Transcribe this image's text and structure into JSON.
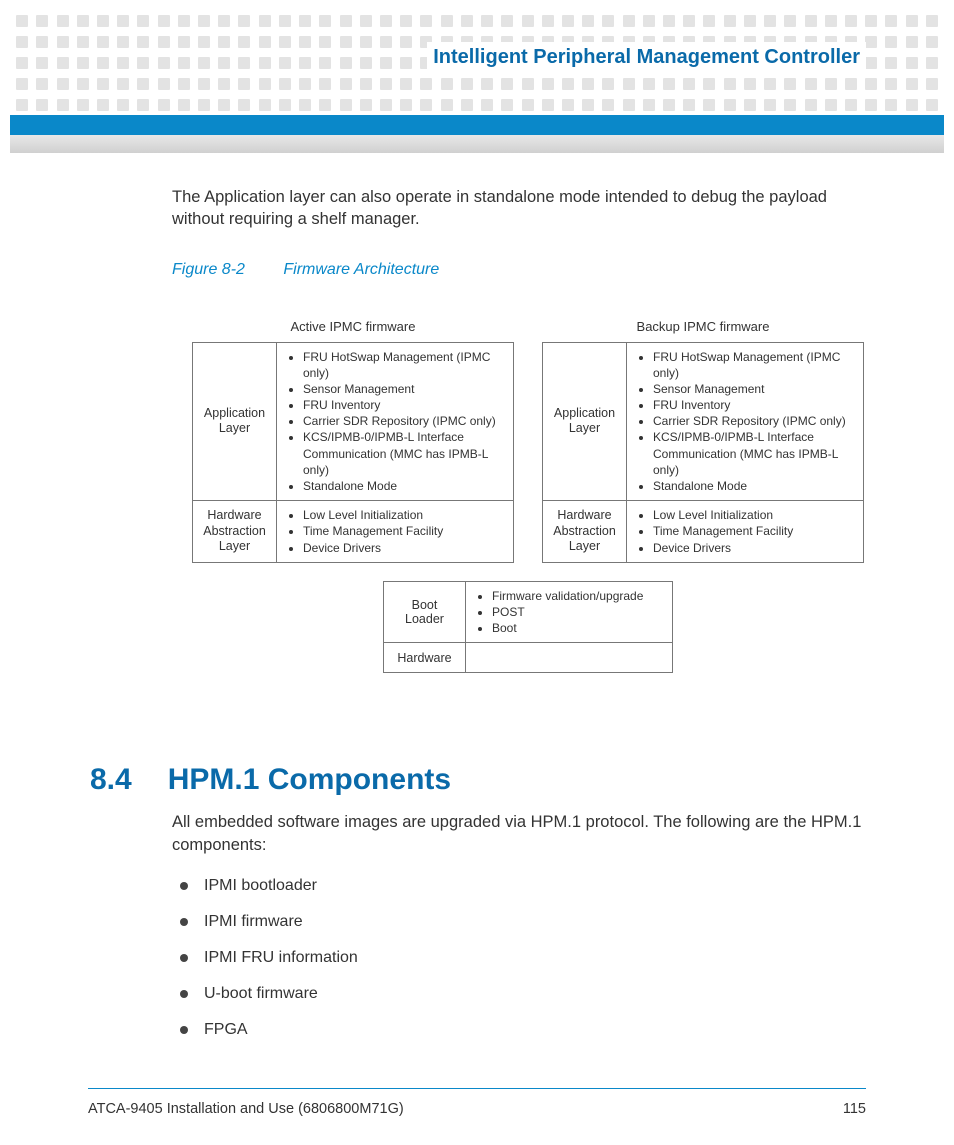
{
  "header": {
    "title": "Intelligent Peripheral Management Controller"
  },
  "intro_paragraph": "The Application layer can also operate in standalone mode intended to debug the payload without requiring a shelf manager.",
  "figure": {
    "label": "Figure 8-2",
    "title": "Firmware Architecture",
    "active": {
      "title": "Active IPMC firmware",
      "app_label": "Application Layer",
      "app_items": [
        "FRU HotSwap Management (IPMC only)",
        "Sensor Management",
        "FRU Inventory",
        "Carrier SDR Repository (IPMC only)",
        "KCS/IPMB-0/IPMB-L Interface Communication (MMC has IPMB-L only)",
        "Standalone Mode"
      ],
      "hal_label": "Hardware Abstraction Layer",
      "hal_items": [
        "Low Level Initialization",
        "Time Management Facility",
        "Device Drivers"
      ]
    },
    "backup": {
      "title": "Backup IPMC firmware",
      "app_label": "Application Layer",
      "app_items": [
        "FRU HotSwap Management (IPMC only)",
        "Sensor Management",
        "FRU Inventory",
        "Carrier SDR Repository (IPMC only)",
        "KCS/IPMB-0/IPMB-L Interface Communication (MMC has IPMB-L only)",
        "Standalone Mode"
      ],
      "hal_label": "Hardware Abstraction Layer",
      "hal_items": [
        "Low Level Initialization",
        "Time Management Facility",
        "Device Drivers"
      ]
    },
    "boot": {
      "label": "Boot Loader",
      "items": [
        "Firmware validation/upgrade",
        "POST",
        "Boot"
      ],
      "hw_label": "Hardware"
    }
  },
  "section": {
    "number": "8.4",
    "title": "HPM.1 Components",
    "paragraph": "All embedded software images are upgraded via HPM.1 protocol. The following are the HPM.1 components:",
    "bullets": [
      "IPMI bootloader",
      "IPMI firmware",
      "IPMI FRU information",
      "U-boot firmware",
      "FPGA"
    ]
  },
  "footer": {
    "doc_title": "ATCA-9405 Installation and Use (6806800M71G)",
    "page": "115"
  }
}
